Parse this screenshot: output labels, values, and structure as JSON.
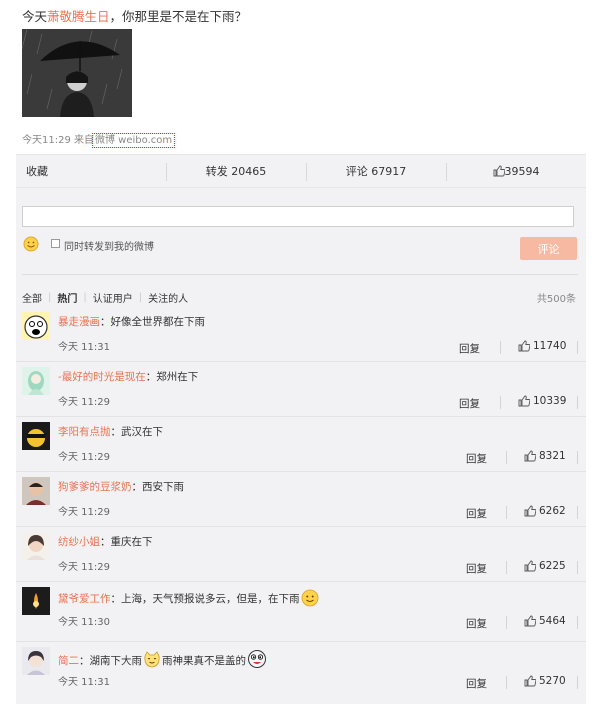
{
  "post": {
    "text_before": "今天",
    "topic": "萧敬腾生日",
    "text_after": "，你那里是不是在下雨？",
    "meta_time_source": "今天11:29 来自",
    "meta_link": "微博 weibo.com"
  },
  "actions": {
    "favorite": "收藏",
    "repost": "转发 20465",
    "comment": "评论 67917",
    "like": "39594"
  },
  "compose": {
    "placeholder": "",
    "repost_checkbox_label": "同时转发到我的微博",
    "submit_label": "评论"
  },
  "filters": {
    "all": "全部",
    "hot": "热门",
    "verified": "认证用户",
    "following": "关注的人",
    "total": "共500条"
  },
  "reply_label": "回复",
  "comments": [
    {
      "user": "暴走漫画",
      "sep": "：",
      "text": "好像全世界都在下雨",
      "time": "今天 11:31",
      "likes": "11740"
    },
    {
      "user": "-最好的时光是现在",
      "sep": "：",
      "text": "郑州在下",
      "time": "今天 11:29",
      "likes": "10339"
    },
    {
      "user": "李阳有点抛",
      "sep": "：",
      "text": "武汉在下",
      "time": "今天 11:29",
      "likes": "8321"
    },
    {
      "user": "狗爹爹的豆浆奶",
      "sep": "：",
      "text": "西安下雨",
      "time": "今天 11:29",
      "likes": "6262"
    },
    {
      "user": "纺纱小姐",
      "sep": "：",
      "text": "重庆在下",
      "time": "今天 11:29",
      "likes": "6225"
    },
    {
      "user": "黛爷爱工作",
      "sep": "：",
      "text": "上海，天气预报说多云，但是，在下雨",
      "time": "今天 11:30",
      "likes": "5464"
    },
    {
      "user": "简二",
      "sep": "：",
      "text_a": "湖南下大雨",
      "text_b": "雨神果真不是盖的",
      "time": "今天 11:31",
      "likes": "5270"
    }
  ],
  "colors": {
    "link": "#eb7350",
    "panel_bg": "#f2f2f5",
    "submit_bg": "#f8b9a2"
  }
}
